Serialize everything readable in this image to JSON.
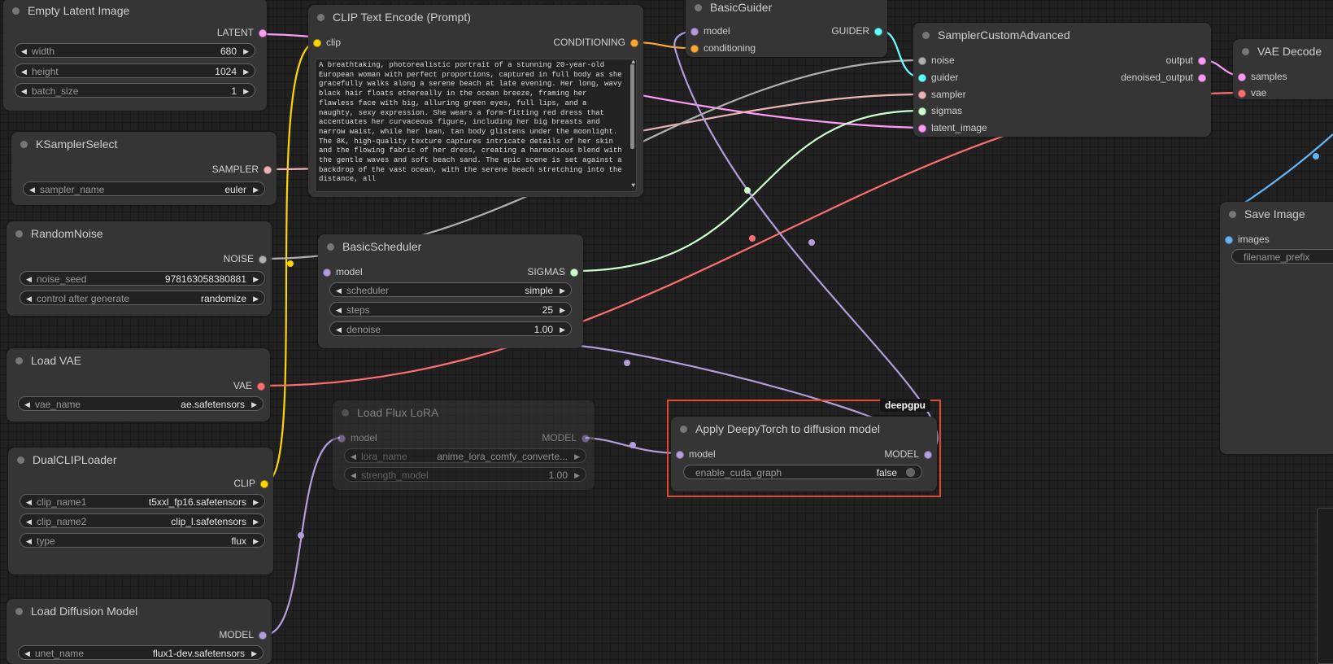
{
  "colors": {
    "latent": "#ff9cf9",
    "clip": "#ffd500",
    "conditioning": "#ffa931",
    "model": "#b39ddb",
    "vae": "#ff6e6e",
    "sampler": "#ecb4b4",
    "sigmas": "#cdffcd",
    "noise": "#b0b0b0",
    "guider": "#66ffff",
    "image": "#64b5f6",
    "highlight": "#e2492f"
  },
  "nodes": {
    "empty_latent": {
      "title": "Empty Latent Image",
      "out_latent": "LATENT",
      "width_label": "width",
      "width_value": "680",
      "height_label": "height",
      "height_value": "1024",
      "batch_label": "batch_size",
      "batch_value": "1"
    },
    "clip_text": {
      "title": "CLIP Text Encode (Prompt)",
      "in_clip": "clip",
      "out_cond": "CONDITIONING",
      "prompt": "A breathtaking, photorealistic portrait of a stunning 20-year-old European woman with perfect proportions, captured in full body as she gracefully walks along a serene beach at late evening. Her long, wavy black hair floats ethereally in the ocean breeze, framing her flawless face with big, alluring green eyes, full lips, and a naughty, sexy expression. She wears a form-fitting red dress that accentuates her curvaceous figure, including her big breasts and narrow waist, while her lean, tan body glistens under the moonlight. The 8K, high-quality texture captures intricate details of her skin and the flowing fabric of her dress, creating a harmonious blend with the gentle waves and soft beach sand. The epic scene is set against a backdrop of the vast ocean, with the serene beach stretching into the distance, all"
    },
    "basic_guider": {
      "title": "BasicGuider",
      "in_model": "model",
      "in_cond": "conditioning",
      "out_guider": "GUIDER"
    },
    "sampler_adv": {
      "title": "SamplerCustomAdvanced",
      "in_noise": "noise",
      "in_guider": "guider",
      "in_sampler": "sampler",
      "in_sigmas": "sigmas",
      "in_latent": "latent_image",
      "out_output": "output",
      "out_denoised": "denoised_output"
    },
    "vae_decode": {
      "title": "VAE Decode",
      "in_samples": "samples",
      "in_vae": "vae"
    },
    "ksampler_select": {
      "title": "KSamplerSelect",
      "out_sampler": "SAMPLER",
      "sampler_label": "sampler_name",
      "sampler_value": "euler"
    },
    "random_noise": {
      "title": "RandomNoise",
      "out_noise": "NOISE",
      "seed_label": "noise_seed",
      "seed_value": "978163058380881",
      "control_label": "control after generate",
      "control_value": "randomize"
    },
    "basic_scheduler": {
      "title": "BasicScheduler",
      "in_model": "model",
      "out_sigmas": "SIGMAS",
      "scheduler_label": "scheduler",
      "scheduler_value": "simple",
      "steps_label": "steps",
      "steps_value": "25",
      "denoise_label": "denoise",
      "denoise_value": "1.00"
    },
    "save_image": {
      "title": "Save Image",
      "in_images": "images",
      "prefix_label": "filename_prefix"
    },
    "load_vae": {
      "title": "Load VAE",
      "out_vae": "VAE",
      "vae_label": "vae_name",
      "vae_value": "ae.safetensors"
    },
    "load_lora": {
      "title": "Load Flux LoRA",
      "in_model": "model",
      "out_model": "MODEL",
      "lora_label": "lora_name",
      "lora_value": "anime_lora_comfy_converte...",
      "strength_label": "strength_model",
      "strength_value": "1.00"
    },
    "deepytorch": {
      "badge": "deepgpu",
      "title": "Apply DeepyTorch to diffusion model",
      "in_model": "model",
      "out_model": "MODEL",
      "cuda_label": "enable_cuda_graph",
      "cuda_value": "false"
    },
    "dual_clip": {
      "title": "DualCLIPLoader",
      "out_clip": "CLIP",
      "clip1_label": "clip_name1",
      "clip1_value": "t5xxl_fp16.safetensors",
      "clip2_label": "clip_name2",
      "clip2_value": "clip_l.safetensors",
      "type_label": "type",
      "type_value": "flux"
    },
    "load_diffusion": {
      "title": "Load Diffusion Model",
      "out_model": "MODEL",
      "unet_label": "unet_name",
      "unet_value": "flux1-dev.safetensors"
    }
  }
}
